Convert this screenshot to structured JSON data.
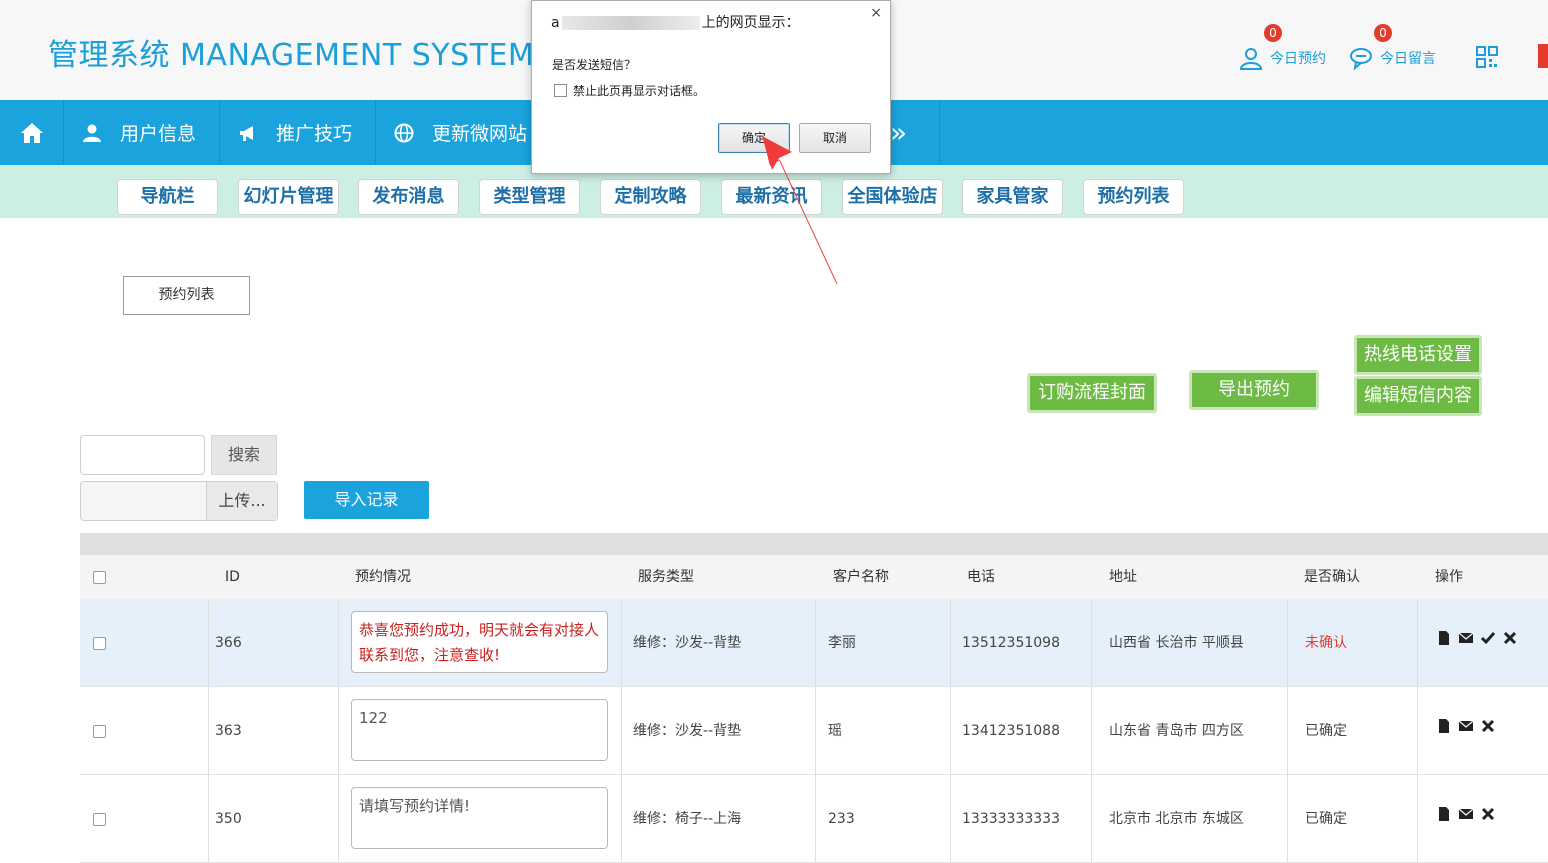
{
  "header": {
    "brand": "管理系统 MANAGEMENT SYSTEM",
    "stats": [
      {
        "label": "今日预约",
        "count": "0",
        "icon": "user-icon"
      },
      {
        "label": "今日留言",
        "count": "0",
        "icon": "chat-icon"
      }
    ],
    "qr_icon": "qr-code-icon"
  },
  "mainnav": [
    {
      "label": "",
      "icon": "home-icon"
    },
    {
      "label": "用户信息",
      "icon": "user-icon"
    },
    {
      "label": "推广技巧",
      "icon": "megaphone-icon"
    },
    {
      "label": "更新微网站",
      "icon": "globe-icon"
    }
  ],
  "mainnav_more": "»",
  "subnav": [
    "导航栏",
    "幻灯片管理",
    "发布消息",
    "类型管理",
    "定制攻略",
    "最新资讯",
    "全国体验店",
    "家具管家",
    "预约列表"
  ],
  "list_tab": "预约列表",
  "actions": {
    "order_cover": "订购流程封面",
    "export": "导出预约",
    "hotline": "热线电话设置",
    "sms_edit": "编辑短信内容"
  },
  "search": {
    "button": "搜索",
    "value": ""
  },
  "upload": {
    "button": "上传...",
    "import": "导入记录"
  },
  "table": {
    "columns": [
      "ID",
      "预约情况",
      "服务类型",
      "客户名称",
      "电话",
      "地址",
      "是否确认",
      "操作"
    ],
    "rows": [
      {
        "id": "366",
        "memo": "恭喜您预约成功，明天就会有对接人联系到您，注意查收!",
        "service": "维修：沙发--背垫",
        "name": "李丽",
        "phone": "13512351098",
        "address": "山西省 长治市 平顺县",
        "status": "未确认"
      },
      {
        "id": "363",
        "memo": "122",
        "service": "维修：沙发--背垫",
        "name": "瑶",
        "phone": "13412351088",
        "address": "山东省 青岛市 四方区",
        "status": "已确定"
      },
      {
        "id": "350",
        "memo": "请填写预约详情!",
        "service": "维修：椅子--上海",
        "name": "233",
        "phone": "13333333333",
        "address": "北京市 北京市 东城区",
        "status": "已确定"
      }
    ]
  },
  "dialog": {
    "title_prefix": "a",
    "title_suffix": "上的网页显示：",
    "close": "×",
    "message": "是否发送短信？",
    "checkbox_label": "禁止此页再显示对话框。",
    "ok": "确定",
    "cancel": "取消"
  },
  "colors": {
    "accent": "#1aa3dc",
    "green": "#6dbb45",
    "red": "#e23c2c"
  }
}
